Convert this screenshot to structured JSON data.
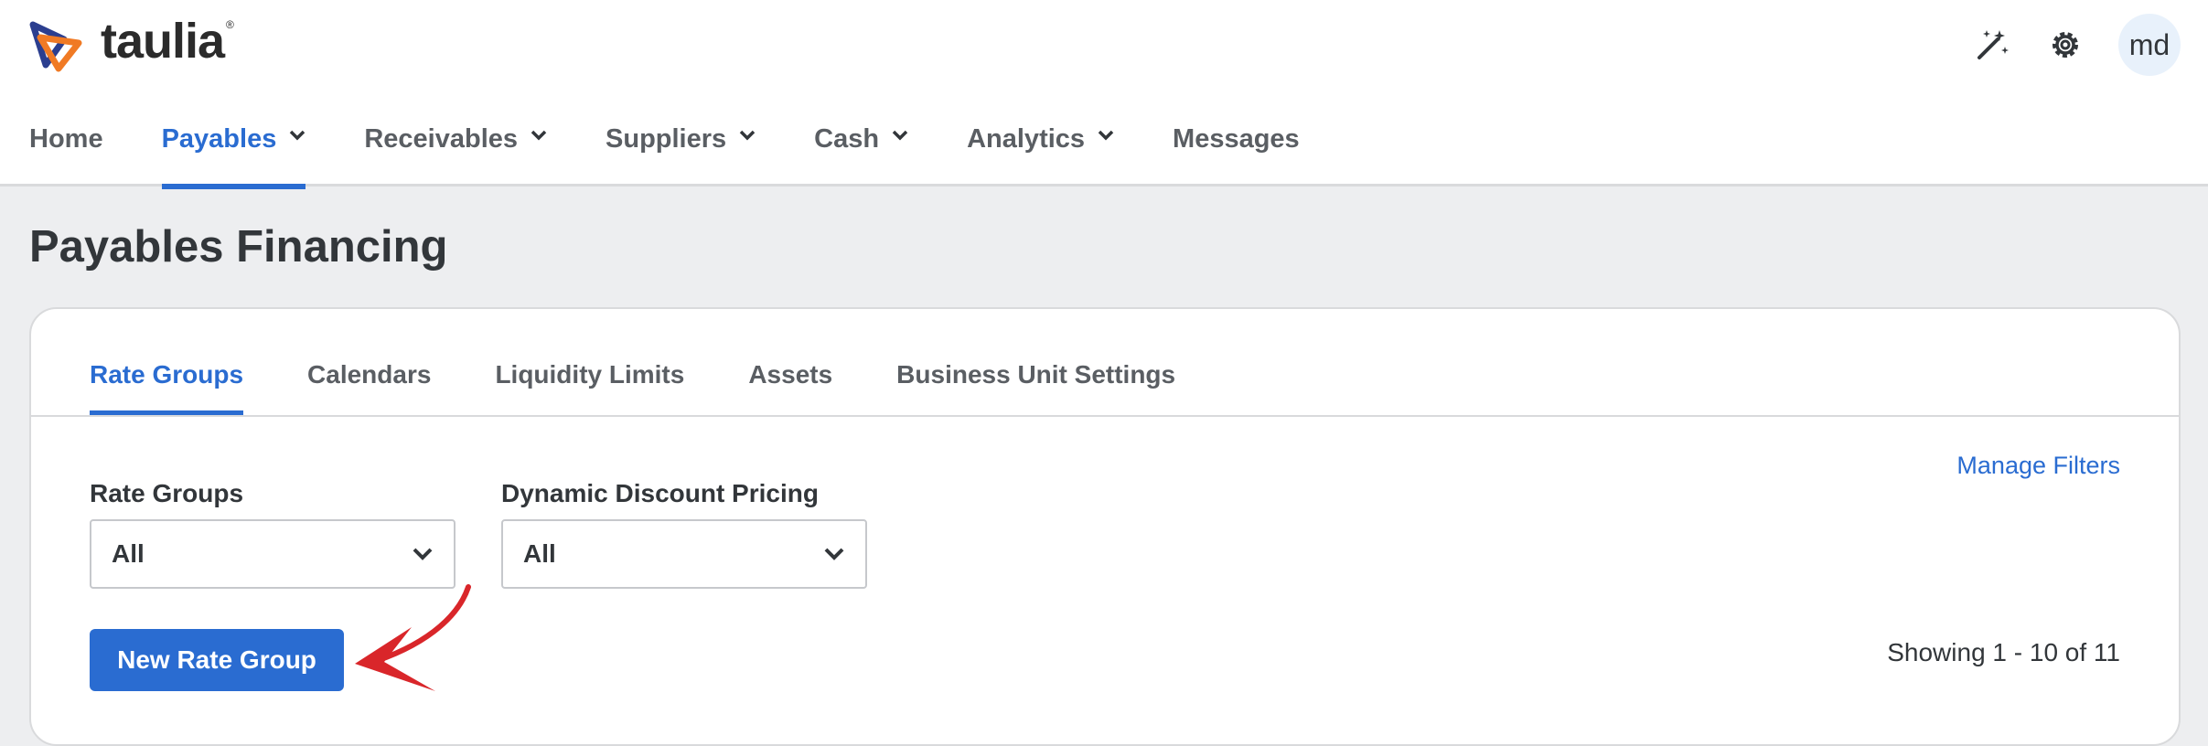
{
  "header": {
    "logo_text": "taulia",
    "logo_mark": "®",
    "icons": [
      "magic-wand-icon",
      "gear-icon"
    ],
    "avatar_initials": "md"
  },
  "nav": [
    {
      "label": "Home",
      "dropdown": false,
      "active": false
    },
    {
      "label": "Payables",
      "dropdown": true,
      "active": true
    },
    {
      "label": "Receivables",
      "dropdown": true,
      "active": false
    },
    {
      "label": "Suppliers",
      "dropdown": true,
      "active": false
    },
    {
      "label": "Cash",
      "dropdown": true,
      "active": false
    },
    {
      "label": "Analytics",
      "dropdown": true,
      "active": false
    },
    {
      "label": "Messages",
      "dropdown": false,
      "active": false
    }
  ],
  "page": {
    "title": "Payables Financing"
  },
  "tabs": [
    {
      "label": "Rate Groups",
      "active": true
    },
    {
      "label": "Calendars",
      "active": false
    },
    {
      "label": "Liquidity Limits",
      "active": false
    },
    {
      "label": "Assets",
      "active": false
    },
    {
      "label": "Business Unit Settings",
      "active": false
    }
  ],
  "filters": {
    "manage_label": "Manage Filters",
    "rate_groups": {
      "label": "Rate Groups",
      "value": "All"
    },
    "dynamic_discount": {
      "label": "Dynamic Discount Pricing",
      "value": "All"
    }
  },
  "actions": {
    "new_rate_group": "New Rate Group"
  },
  "pagination": {
    "showing": "Showing 1 - 10 of 11"
  },
  "colors": {
    "accent": "#2a6cd1",
    "annotation": "#d9262a"
  }
}
